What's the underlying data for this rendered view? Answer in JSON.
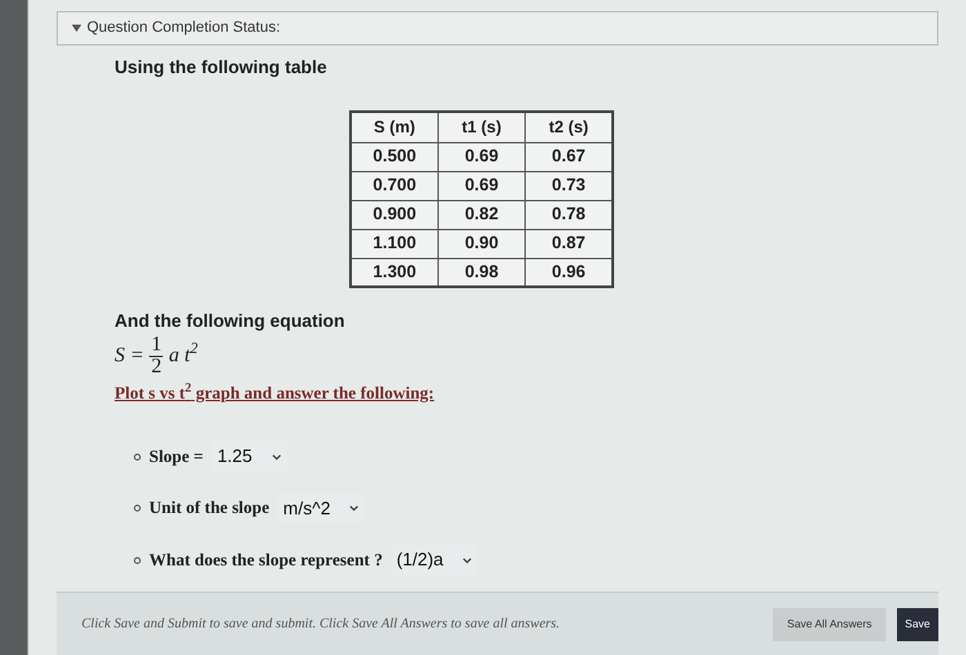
{
  "status_header": {
    "label": "Question Completion Status:",
    "expanded": true
  },
  "intro": "Using the following table",
  "table": {
    "columns": [
      "S (m)",
      "t1 (s)",
      "t2 (s)"
    ],
    "rows": [
      [
        "0.500",
        "0.69",
        "0.67"
      ],
      [
        "0.700",
        "0.69",
        "0.73"
      ],
      [
        "0.900",
        "0.82",
        "0.78"
      ],
      [
        "1.100",
        "0.90",
        "0.87"
      ],
      [
        "1.300",
        "0.98",
        "0.96"
      ]
    ]
  },
  "equation_intro": "And the following equation",
  "equation": {
    "lhs": "S =",
    "numerator": "1",
    "denominator": "2",
    "rhs": "a t$^{2}$"
  },
  "instruction": "Plot s vs t$^{2}$ graph and answer the following:",
  "questions": [
    {
      "label": "Slope =",
      "value": "1.25"
    },
    {
      "label": "Unit of the slope",
      "value": "m/s^2"
    },
    {
      "label": "What does the slope represent ?",
      "value": "(1/2)a"
    }
  ],
  "footer": {
    "note": "Click Save and Submit to save and submit. Click Save All Answers to save all answers.",
    "buttons": [
      {
        "label": "Save All Answers",
        "kind": "secondary"
      },
      {
        "label": "Save",
        "kind": "primary"
      }
    ]
  }
}
